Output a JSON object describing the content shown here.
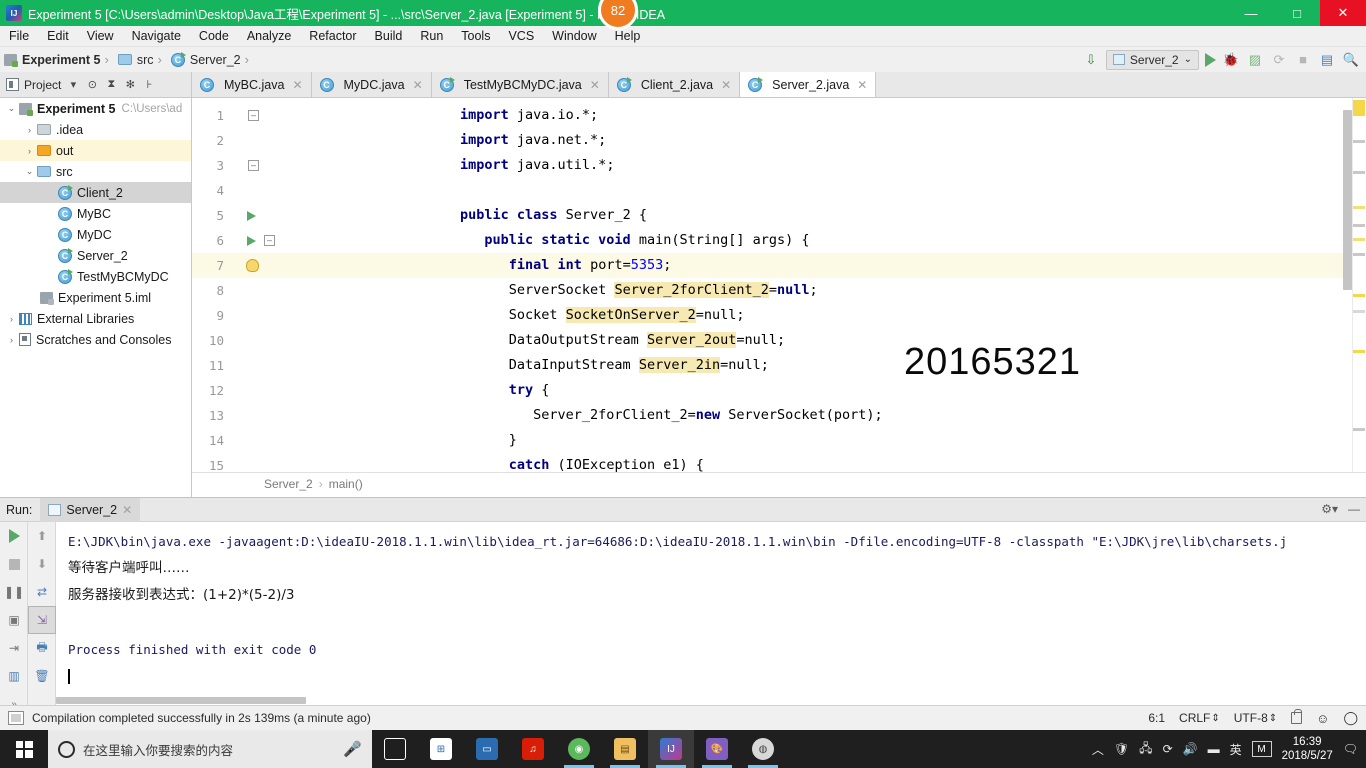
{
  "window": {
    "title": "Experiment 5 [C:\\Users\\admin\\Desktop\\Java工程\\Experiment 5] - ...\\src\\Server_2.java [Experiment 5] - IntelliJ IDEA",
    "badge": "82",
    "minimize": "—",
    "maximize": "□",
    "close": "✕",
    "titlebar_color": "#16b45c"
  },
  "menubar": {
    "items": [
      "File",
      "Edit",
      "View",
      "Navigate",
      "Code",
      "Analyze",
      "Refactor",
      "Build",
      "Run",
      "Tools",
      "VCS",
      "Window",
      "Help"
    ]
  },
  "navbar": {
    "breadcrumb": [
      {
        "label": "Experiment 5",
        "icon": "module-icon"
      },
      {
        "label": "src",
        "icon": "folder-icon"
      },
      {
        "label": "Server_2",
        "icon": "java-class-icon"
      }
    ],
    "separator": "›",
    "run_config": "Server_2",
    "run_config_caret": "⌄"
  },
  "toolwindow_bar": {
    "project_label": "Project",
    "dropdown_caret": "▾"
  },
  "editor_tabs": [
    {
      "label": "MyBC.java",
      "active": false,
      "close": "✕"
    },
    {
      "label": "MyDC.java",
      "active": false,
      "close": "✕"
    },
    {
      "label": "TestMyBCMyDC.java",
      "active": false,
      "close": "✕"
    },
    {
      "label": "Client_2.java",
      "active": false,
      "close": "✕"
    },
    {
      "label": "Server_2.java",
      "active": true,
      "close": "✕"
    }
  ],
  "project_tree": [
    {
      "label": "Experiment 5",
      "path": "C:\\Users\\ad",
      "arrow": "⌄",
      "indent": 0,
      "icon": "module-icon",
      "bold": true,
      "state": "normal"
    },
    {
      "label": ".idea",
      "path": "",
      "arrow": "›",
      "indent": 1,
      "icon": "folder-idea-icon",
      "bold": false,
      "state": "normal"
    },
    {
      "label": "out",
      "path": "",
      "arrow": "›",
      "indent": 1,
      "icon": "folder-out-icon",
      "bold": false,
      "state": "highlight"
    },
    {
      "label": "src",
      "path": "",
      "arrow": "⌄",
      "indent": 1,
      "icon": "folder-src-icon",
      "bold": false,
      "state": "normal"
    },
    {
      "label": "Client_2",
      "path": "",
      "arrow": "",
      "indent": 2,
      "icon": "java-class-runnable-icon",
      "bold": false,
      "state": "selected"
    },
    {
      "label": "MyBC",
      "path": "",
      "arrow": "",
      "indent": 2,
      "icon": "java-class-icon",
      "bold": false,
      "state": "normal"
    },
    {
      "label": "MyDC",
      "path": "",
      "arrow": "",
      "indent": 2,
      "icon": "java-class-icon",
      "bold": false,
      "state": "normal"
    },
    {
      "label": "Server_2",
      "path": "",
      "arrow": "",
      "indent": 2,
      "icon": "java-class-runnable-icon",
      "bold": false,
      "state": "normal"
    },
    {
      "label": "TestMyBCMyDC",
      "path": "",
      "arrow": "",
      "indent": 2,
      "icon": "java-class-runnable-icon",
      "bold": false,
      "state": "normal"
    },
    {
      "label": "Experiment 5.iml",
      "path": "",
      "arrow": "",
      "indent": 1,
      "icon": "iml-file-icon",
      "bold": false,
      "state": "normal"
    },
    {
      "label": "External Libraries",
      "path": "",
      "arrow": "›",
      "indent": 0,
      "icon": "library-icon",
      "bold": false,
      "state": "normal"
    },
    {
      "label": "Scratches and Consoles",
      "path": "",
      "arrow": "›",
      "indent": 0,
      "icon": "scratch-icon",
      "bold": false,
      "state": "normal"
    }
  ],
  "code": {
    "watermark": "20165321",
    "lines": [
      {
        "n": "1",
        "text": "import java.io.*;",
        "marker": "fold-minus",
        "hl": false
      },
      {
        "n": "2",
        "text": "import java.net.*;",
        "marker": "",
        "hl": false
      },
      {
        "n": "3",
        "text": "import java.util.*;",
        "marker": "fold-minus",
        "hl": false
      },
      {
        "n": "4",
        "text": "",
        "marker": "",
        "hl": false
      },
      {
        "n": "5",
        "text": "public class Server_2 {",
        "marker": "run",
        "hl": false
      },
      {
        "n": "6",
        "text": "    public static void main(String[] args) {",
        "marker": "run-fold",
        "hl": false
      },
      {
        "n": "7",
        "text": "        final int port=5353;",
        "marker": "bulb",
        "hl": true
      },
      {
        "n": "8",
        "text": "        ServerSocket Server_2forClient_2=null;",
        "marker": "",
        "hl": false
      },
      {
        "n": "9",
        "text": "        Socket SocketOnServer_2=null;",
        "marker": "",
        "hl": false
      },
      {
        "n": "10",
        "text": "        DataOutputStream Server_2out=null;",
        "marker": "",
        "hl": false
      },
      {
        "n": "11",
        "text": "        DataInputStream Server_2in=null;",
        "marker": "",
        "hl": false
      },
      {
        "n": "12",
        "text": "        try {",
        "marker": "",
        "hl": false
      },
      {
        "n": "13",
        "text": "            Server_2forClient_2=new ServerSocket(port);",
        "marker": "",
        "hl": false
      },
      {
        "n": "14",
        "text": "        }",
        "marker": "",
        "hl": false
      },
      {
        "n": "15",
        "text": "        catch (IOException e1) {",
        "marker": "",
        "hl": false
      }
    ],
    "breadcrumb": [
      "Server_2",
      "main()"
    ],
    "breadcrumb_sep": "›"
  },
  "run_window": {
    "label": "Run:",
    "tab": "Server_2",
    "tab_close": "✕",
    "console": [
      {
        "text": "E:\\JDK\\bin\\java.exe -javaagent:D:\\ideaIU-2018.1.1.win\\lib\\idea_rt.jar=64686:D:\\ideaIU-2018.1.1.win\\bin -Dfile.encoding=UTF-8 -classpath \"E:\\JDK\\jre\\lib\\charsets.j",
        "zh": false
      },
      {
        "text": "等待客户端呼叫……",
        "zh": true
      },
      {
        "text": "服务器接收到表达式：(1+2)*(5-2)/3",
        "zh": true
      },
      {
        "text": "",
        "zh": false
      },
      {
        "text": "Process finished with exit code 0",
        "zh": false
      }
    ]
  },
  "statusbar": {
    "message": "Compilation completed successfully in 2s 139ms (a minute ago)",
    "caret_position": "6:1",
    "line_separator": "CRLF",
    "encoding": "UTF-8",
    "selector_caret": "⇕"
  },
  "taskbar": {
    "search_placeholder": "在这里输入你要搜索的内容",
    "clock_time": "16:39",
    "clock_date": "2018/5/27",
    "ime_language": "英",
    "ime_mode": "M",
    "apps": [
      {
        "name": "task-view",
        "glyph": "❐",
        "color": "transparent",
        "open": false,
        "active": false
      },
      {
        "name": "microsoft-store",
        "glyph": "⊞",
        "color": "#ffffff",
        "open": false,
        "active": false
      },
      {
        "name": "remote-desktop",
        "glyph": "🖥",
        "color": "#2b6cb0",
        "open": false,
        "active": false
      },
      {
        "name": "netease-music",
        "glyph": "♫",
        "color": "#d81e06",
        "open": false,
        "active": false
      },
      {
        "name": "browser",
        "glyph": "◉",
        "color": "#5cb85c",
        "open": true,
        "active": false
      },
      {
        "name": "file-explorer",
        "glyph": "📁",
        "color": "#f0c060",
        "open": true,
        "active": false
      },
      {
        "name": "intellij-idea",
        "glyph": "IJ",
        "color": "#c0398b",
        "open": true,
        "active": true
      },
      {
        "name": "paint",
        "glyph": "🎨",
        "color": "#7f5fc0",
        "open": true,
        "active": false
      },
      {
        "name": "app-extra",
        "glyph": "◍",
        "color": "#d8d8d8",
        "open": true,
        "active": false
      }
    ]
  }
}
